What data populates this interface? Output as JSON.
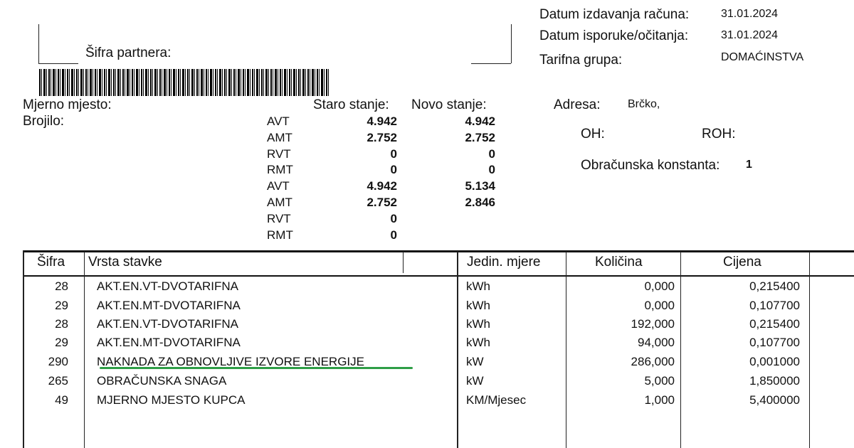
{
  "header": {
    "invoice_date_label": "Datum izdavanja računa:",
    "invoice_date": "31.01.2024",
    "delivery_date_label": "Datum isporuke/očitanja:",
    "delivery_date": "31.01.2024",
    "tariff_label": "Tarifna grupa:",
    "tariff": "DOMAĆINSTVA",
    "partner_label": "Šifra partnera:"
  },
  "meter": {
    "place_label": "Mjerno mjesto:",
    "meter_label": "Brojilo:",
    "old_label": "Staro stanje:",
    "new_label": "Novo stanje:",
    "rows": [
      {
        "code": "AVT",
        "old": "4.942",
        "new": "4.942"
      },
      {
        "code": "AMT",
        "old": "2.752",
        "new": "2.752"
      },
      {
        "code": "RVT",
        "old": "0",
        "new": "0"
      },
      {
        "code": "RMT",
        "old": "0",
        "new": "0"
      },
      {
        "code": "AVT",
        "old": "4.942",
        "new": "5.134"
      },
      {
        "code": "AMT",
        "old": "2.752",
        "new": "2.846"
      },
      {
        "code": "RVT",
        "old": "0",
        "new": ""
      },
      {
        "code": "RMT",
        "old": "0",
        "new": ""
      }
    ]
  },
  "address": {
    "address_label": "Adresa:",
    "address_value": "Brčko,",
    "oh_label": "OH:",
    "roh_label": "ROH:",
    "const_label": "Obračunska konstanta:",
    "const_value": "1"
  },
  "table": {
    "headers": {
      "code": "Šifra",
      "item": "Vrsta stavke",
      "unit": "Jedin. mjere",
      "qty": "Količina",
      "price": "Cijena"
    },
    "rows": [
      {
        "code": "28",
        "item": "AKT.EN.VT-DVOTARIFNA",
        "unit": "kWh",
        "qty": "0,000",
        "price": "0,215400"
      },
      {
        "code": "29",
        "item": "AKT.EN.MT-DVOTARIFNA",
        "unit": "kWh",
        "qty": "0,000",
        "price": "0,107700"
      },
      {
        "code": "28",
        "item": "AKT.EN.VT-DVOTARIFNA",
        "unit": "kWh",
        "qty": "192,000",
        "price": "0,215400"
      },
      {
        "code": "29",
        "item": "AKT.EN.MT-DVOTARIFNA",
        "unit": "kWh",
        "qty": "94,000",
        "price": "0,107700"
      },
      {
        "code": "290",
        "item": "NAKNADA ZA OBNOVLJIVE IZVORE ENERGIJE",
        "unit": "kW",
        "qty": "286,000",
        "price": "0,001000"
      },
      {
        "code": "265",
        "item": "OBRAČUNSKA SNAGA",
        "unit": "kW",
        "qty": "5,000",
        "price": "1,850000"
      },
      {
        "code": "49",
        "item": "MJERNO MJESTO KUPCA",
        "unit": "KM/Mjesec",
        "qty": "1,000",
        "price": "5,400000"
      }
    ]
  },
  "colors": {
    "highlight_underline": "#2e9e46"
  }
}
